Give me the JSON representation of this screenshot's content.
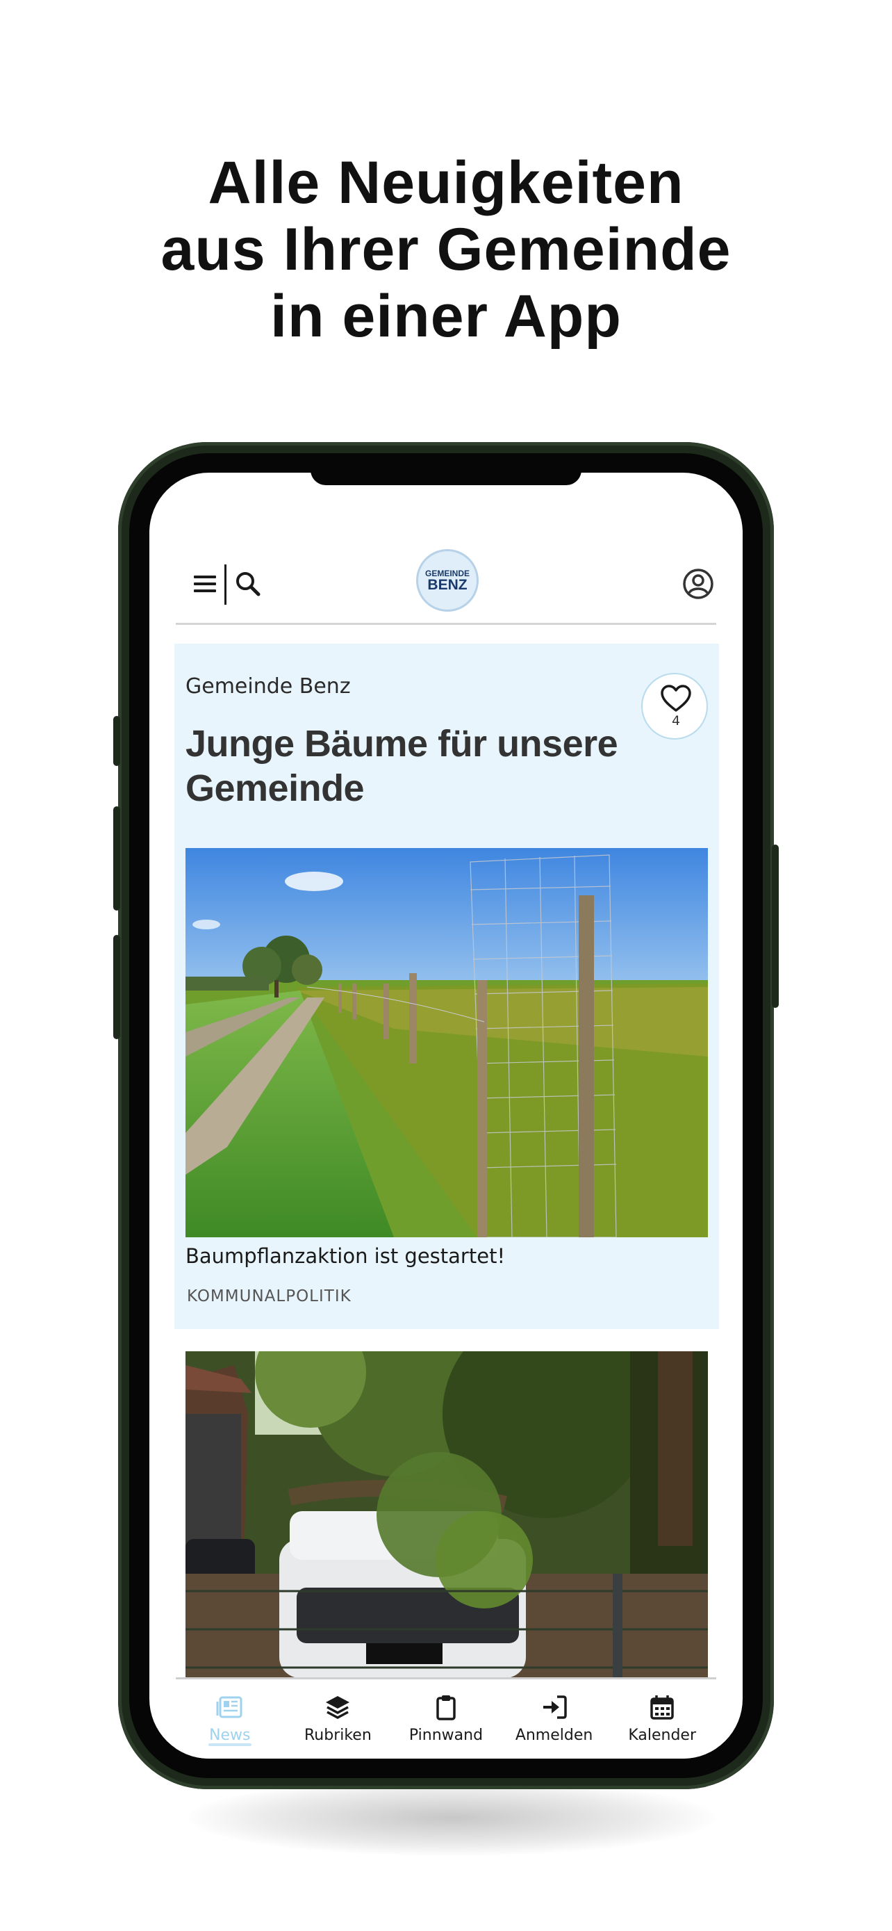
{
  "promo": {
    "headline": [
      "Alle Neuigkeiten",
      "aus Ihrer Gemeinde",
      "in einer App"
    ]
  },
  "app": {
    "logo": {
      "line1": "GEMEINDE",
      "line2": "BENZ"
    },
    "header_icons": [
      "menu-icon",
      "search-icon",
      "account-icon"
    ],
    "feed": [
      {
        "source": "Gemeinde Benz",
        "title": "Junge Bäume für unsere Gemeinde",
        "likes": "4",
        "image": "young trees with wire guards along a field path",
        "caption": "Baumpflanzaktion ist gestartet!",
        "category": "KOMMUNALPOLITIK"
      },
      {
        "image": "fallen tree on a white van"
      }
    ],
    "tabs": [
      {
        "label": "News",
        "icon": "news-icon",
        "active": true
      },
      {
        "label": "Rubriken",
        "icon": "layers-icon",
        "active": false
      },
      {
        "label": "Pinnwand",
        "icon": "clipboard-icon",
        "active": false
      },
      {
        "label": "Anmelden",
        "icon": "login-icon",
        "active": false
      },
      {
        "label": "Kalender",
        "icon": "calendar-icon",
        "active": false
      }
    ],
    "colors": {
      "card_background": "#e8f5fc",
      "active_tab": "#9fd2ee",
      "phone_frame": "#1d2a1b"
    }
  }
}
